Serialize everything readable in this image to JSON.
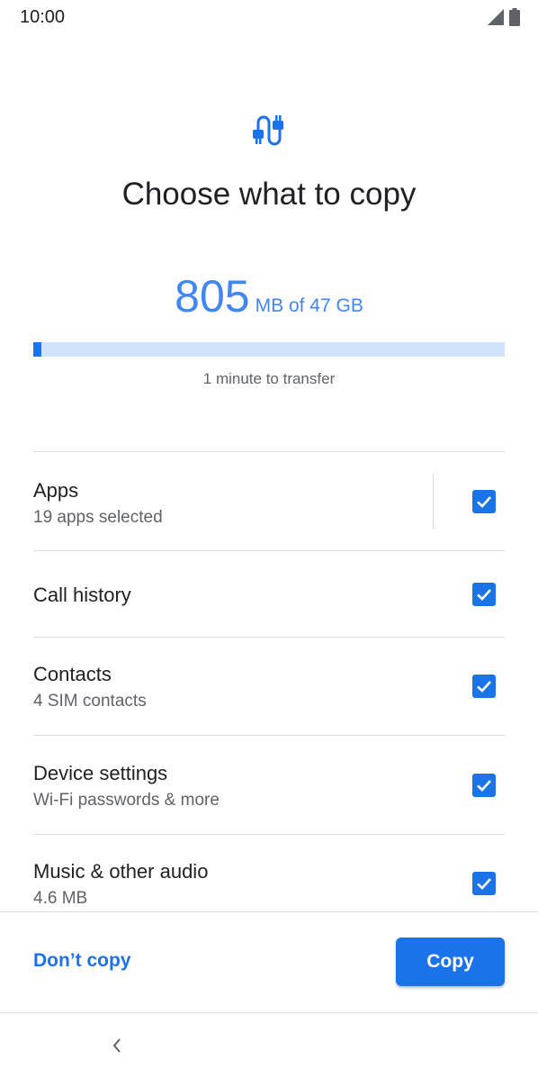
{
  "status_bar": {
    "time": "10:00",
    "icons": [
      "signal-icon",
      "battery-icon"
    ]
  },
  "header": {
    "icon": "data-transfer-icon",
    "title": "Choose what to copy"
  },
  "storage": {
    "amount": "805",
    "rest": "MB of 47 GB",
    "progress_fraction": 0.017,
    "transfer_time": "1 minute to transfer"
  },
  "items": [
    {
      "title": "Apps",
      "subtitle": "19 apps selected",
      "checked": true
    },
    {
      "title": "Call history",
      "subtitle": "",
      "checked": true
    },
    {
      "title": "Contacts",
      "subtitle": "4 SIM contacts",
      "checked": true
    },
    {
      "title": "Device settings",
      "subtitle": "Wi-Fi passwords & more",
      "checked": true
    },
    {
      "title": "Music & other audio",
      "subtitle": "4.6 MB",
      "checked": true
    }
  ],
  "actions": {
    "dont_copy": "Don’t copy",
    "copy": "Copy"
  },
  "nav": {
    "back_icon": "chevron-left-icon"
  },
  "colors": {
    "accent": "#1a73e8",
    "accent_light": "#4285f4",
    "progress_track": "#d2e3fc"
  }
}
